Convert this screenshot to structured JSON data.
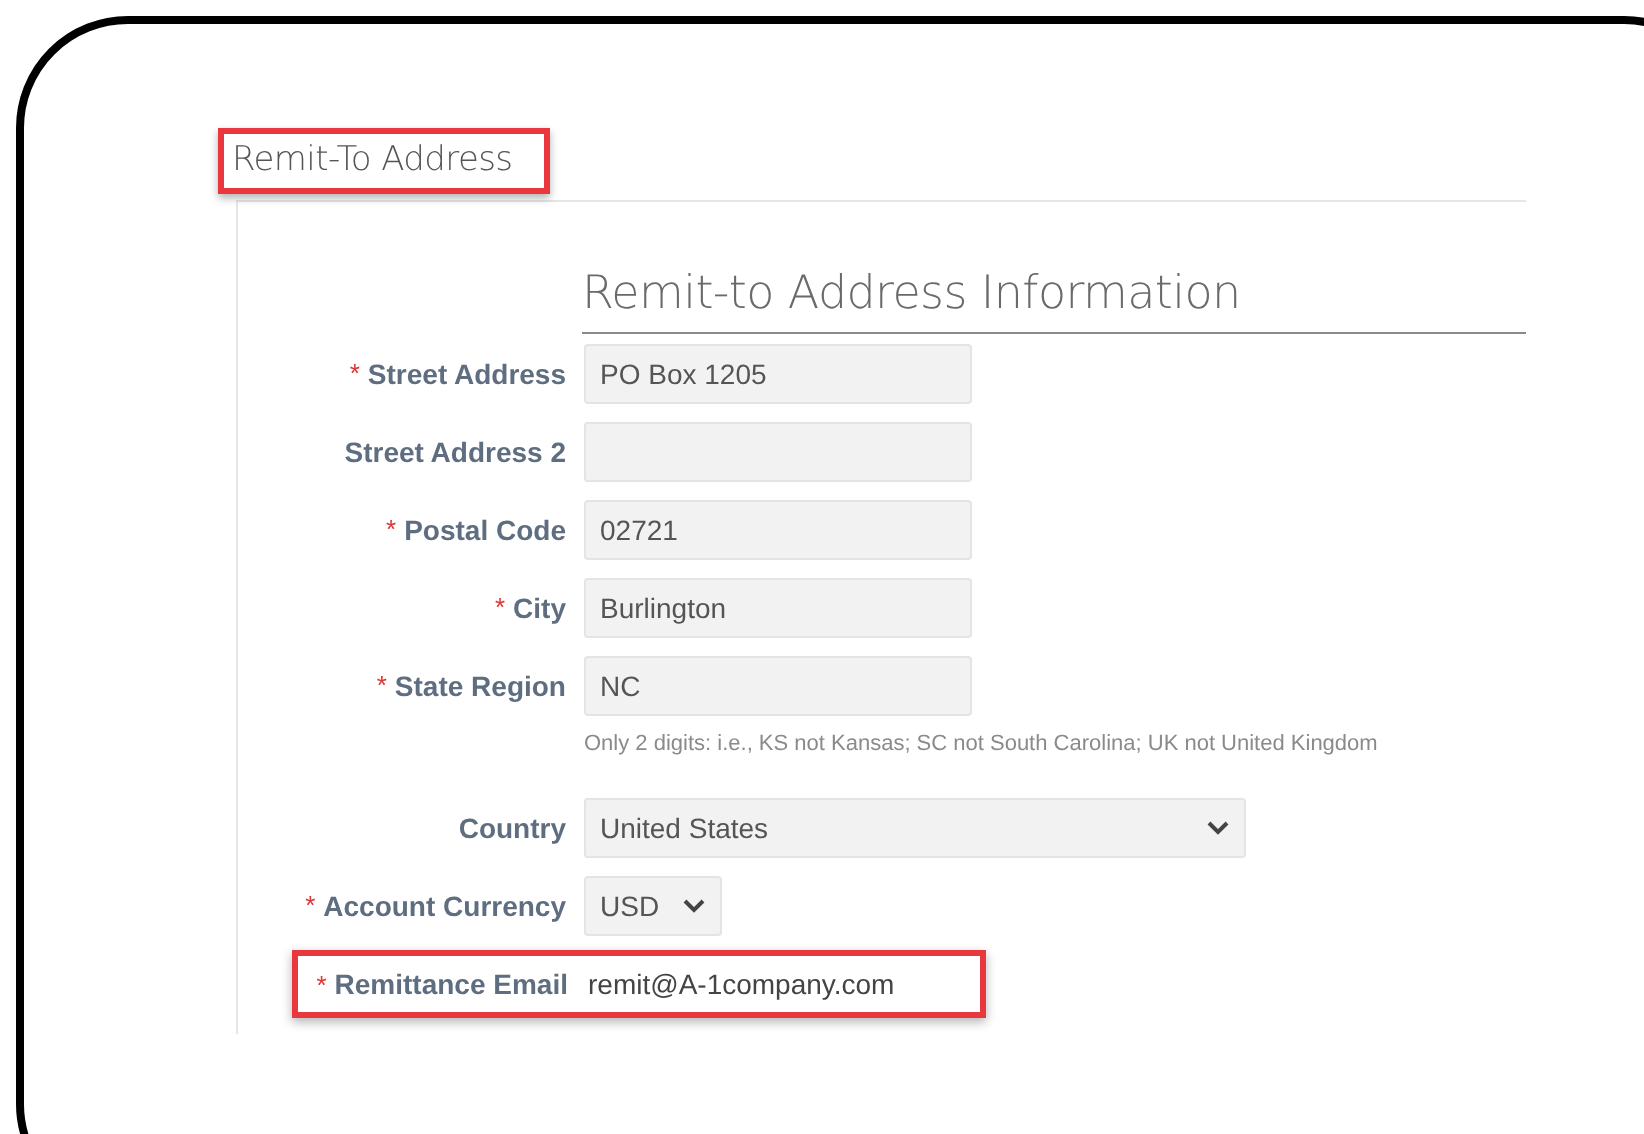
{
  "section": {
    "title": "Remit-To Address",
    "highlighted": true
  },
  "form": {
    "heading": "Remit-to Address Information",
    "rows": [
      {
        "kind": "text",
        "marker": "*",
        "label": "Street Address",
        "value": "PO Box 1205",
        "highlighted": false
      },
      {
        "kind": "text",
        "label": "Street Address 2",
        "value": "",
        "highlighted": false
      },
      {
        "kind": "text",
        "marker": "*",
        "label": "Postal Code",
        "value": "02721",
        "highlighted": false
      },
      {
        "kind": "text",
        "marker": "*",
        "label": "City",
        "value": "Burlington",
        "highlighted": false
      },
      {
        "kind": "text",
        "marker": "*",
        "label": "State Region",
        "value": "NC",
        "highlighted": false,
        "hint": "Only 2 digits: i.e., KS not Kansas; SC not South Carolina; UK not United Kingdom"
      },
      {
        "kind": "dropdown",
        "label": "Country",
        "value": "United States",
        "highlighted": false
      },
      {
        "kind": "shortdropdown",
        "marker": "*",
        "label": "Account Currency",
        "value": "USD",
        "highlighted": false
      },
      {
        "kind": "plain",
        "marker": "*",
        "label": "Remittance Email",
        "value": "remit@A-1company.com",
        "highlighted": true
      }
    ]
  }
}
